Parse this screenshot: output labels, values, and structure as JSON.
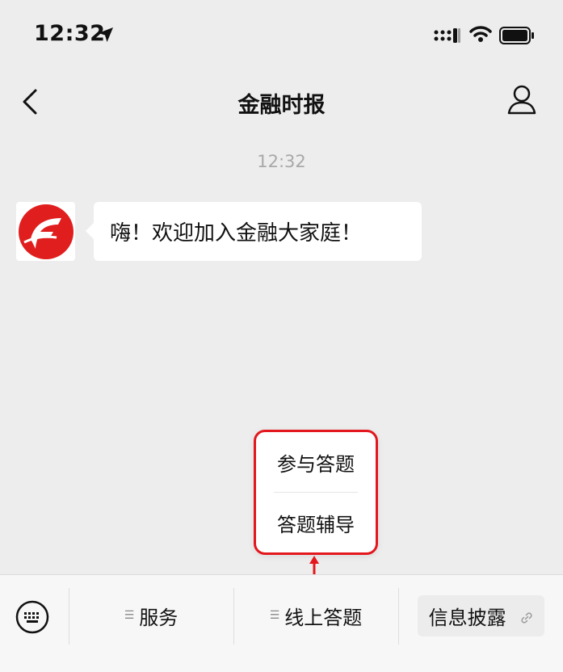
{
  "status_bar": {
    "time": "12:32"
  },
  "nav": {
    "title": "金融时报"
  },
  "chat": {
    "timestamp": "12:32",
    "messages": [
      {
        "sender": "金融时报",
        "text": "嗨！欢迎加入金融大家庭！"
      }
    ]
  },
  "submenu": {
    "items": [
      "参与答题",
      "答题辅导"
    ]
  },
  "bottom_menu": {
    "tabs": [
      "服务",
      "线上答题",
      "信息披露"
    ]
  },
  "colors": {
    "highlight_red": "#e3171d",
    "background": "#ededed",
    "bubble": "#ffffff"
  },
  "icons": [
    "location-arrow-icon",
    "signal-icon",
    "wifi-icon",
    "battery-icon",
    "back-chevron-icon",
    "profile-icon",
    "keyboard-icon",
    "menu-lines-icon",
    "link-icon",
    "annotation-arrow-icon"
  ]
}
